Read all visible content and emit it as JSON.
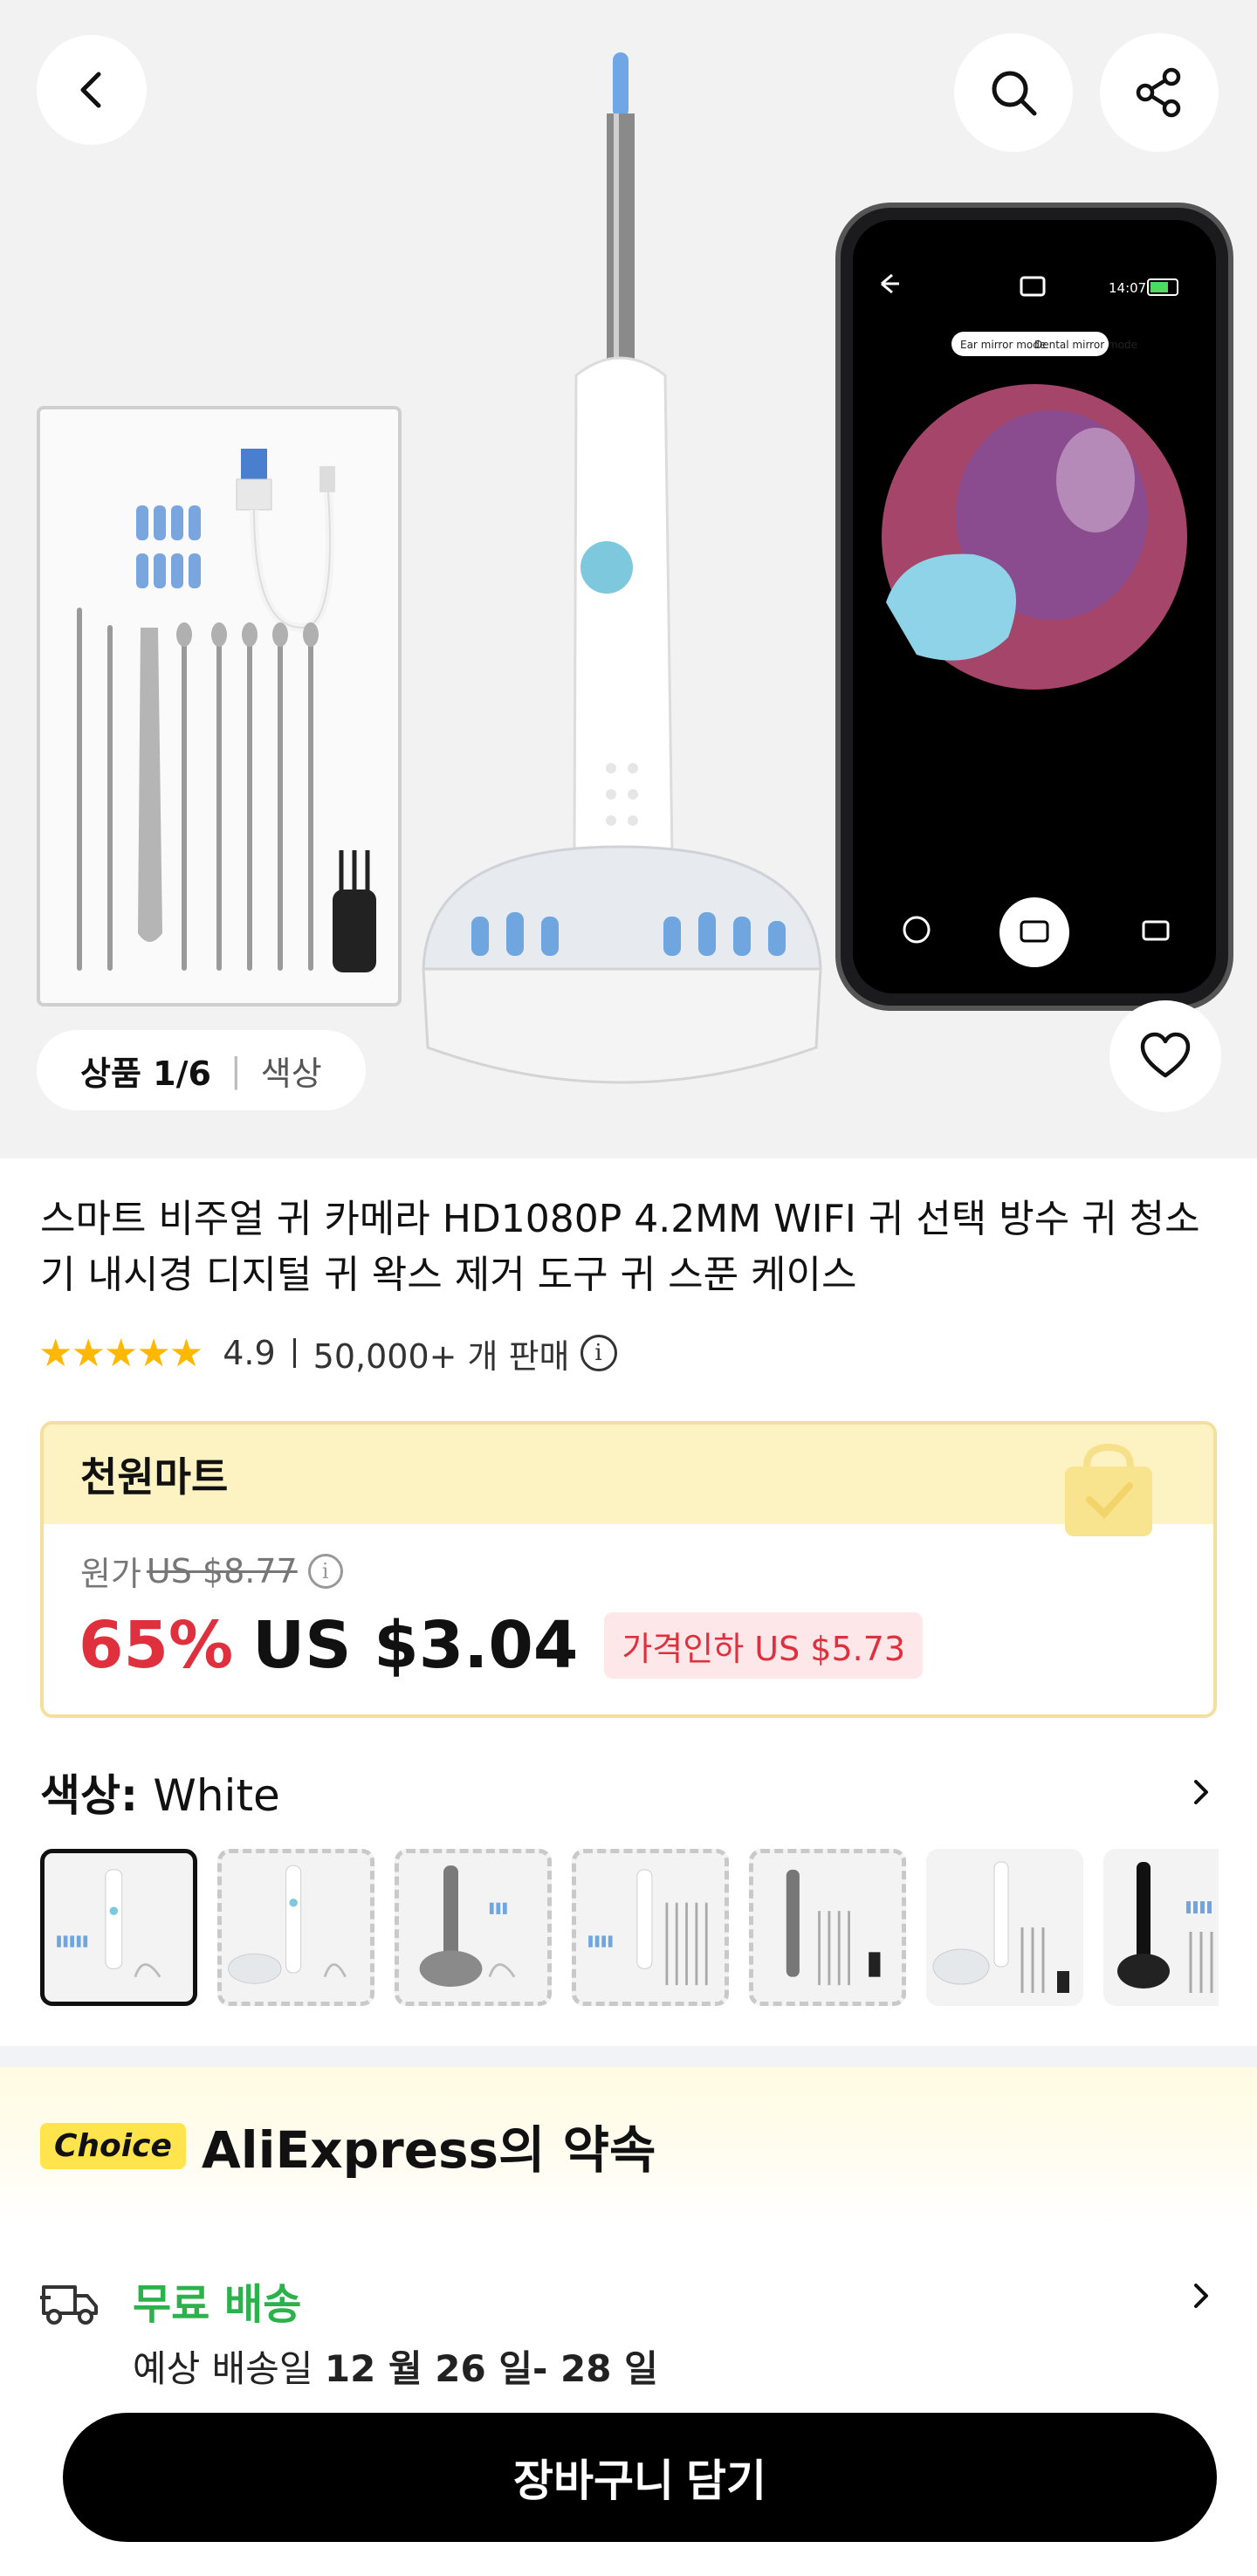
{
  "gallery": {
    "counter_current": "상품 1/6",
    "counter_separator": "|",
    "counter_label": "색상",
    "phone_mode_left": "Ear mirror mode",
    "phone_mode_right": "Dental mirror mode",
    "phone_time": "14:07"
  },
  "product": {
    "title": "스마트 비주얼 귀 카메라 HD1080P 4.2MM WIFI 귀 선택 방수 귀 청소기 내시경 디지털 귀 왁스 제거 도구 귀 스푼 케이스",
    "stars": "★★★★★",
    "rating": "4.9",
    "sold": "50,000+ 개 판매"
  },
  "deal": {
    "name": "천원마트",
    "original_label": "원가",
    "original_price": "US $8.77",
    "discount": "65%",
    "price": "US $3.04",
    "price_drop": "가격인하 US $5.73"
  },
  "color": {
    "label": "색상:",
    "value": "White",
    "thumbnail_count": 7,
    "selected_index": 0
  },
  "choice": {
    "badge": "Choice",
    "title": "AliExpress의 약속"
  },
  "shipping": {
    "free_label": "무료 배송",
    "date_prefix": "예상 배송일",
    "date_range": "12 월 26 일- 28 일"
  },
  "cta": {
    "label": "장바구니 담기"
  },
  "colors": {
    "accent_red": "#e0303e",
    "star": "#ffb800",
    "free_green": "#2bb24c",
    "deal_header": "#fdf2c2",
    "choice_badge": "#ffe44d"
  },
  "icons": {
    "back": "chevron-left-icon",
    "search": "search-icon",
    "share": "share-icon",
    "wishlist": "heart-icon",
    "truck": "truck-icon",
    "info": "info-icon"
  }
}
